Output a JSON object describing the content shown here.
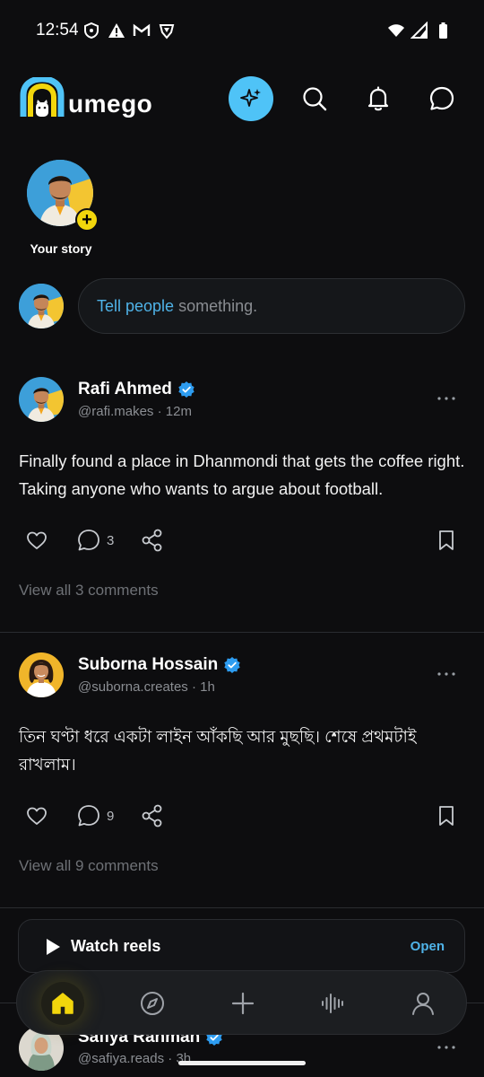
{
  "status_bar": {
    "time": "12:54"
  },
  "header": {
    "app_name": "umego",
    "icons": [
      "sparkle-icon",
      "search-icon",
      "bell-icon",
      "chat-icon"
    ]
  },
  "stories": {
    "your_story_label": "Your story"
  },
  "composer": {
    "placeholder_highlight": "Tell people",
    "placeholder_rest": " something."
  },
  "posts": [
    {
      "name": "Rafi Ahmed",
      "handle": "@rafi.makes",
      "time": "12m",
      "text": "Finally found a place in Dhanmondi that gets the coffee right. Taking anyone who wants to argue about football.",
      "comment_count": "3",
      "view_comments": "View all 3 comments"
    },
    {
      "name": "Suborna Hossain",
      "handle": "@suborna.creates",
      "time": "1h",
      "text": "তিন ঘণ্টা ধরে একটা লাইন আঁকছি আর মুছছি। শেষে প্রথমটাই রাখলাম।",
      "comment_count": "9",
      "view_comments": "View all 9 comments"
    },
    {
      "name": "Safiya Rahman",
      "handle": "@safiya.reads",
      "time": "3h"
    }
  ],
  "reels": {
    "label": "Watch reels",
    "action": "Open"
  },
  "nav": {
    "items": [
      "home-icon",
      "compass-icon",
      "plus-icon",
      "audio-wave-icon",
      "profile-icon"
    ]
  },
  "colors": {
    "accent": "#4fb3e8",
    "highlight": "#f2d60c",
    "background": "#0d0d0f"
  }
}
